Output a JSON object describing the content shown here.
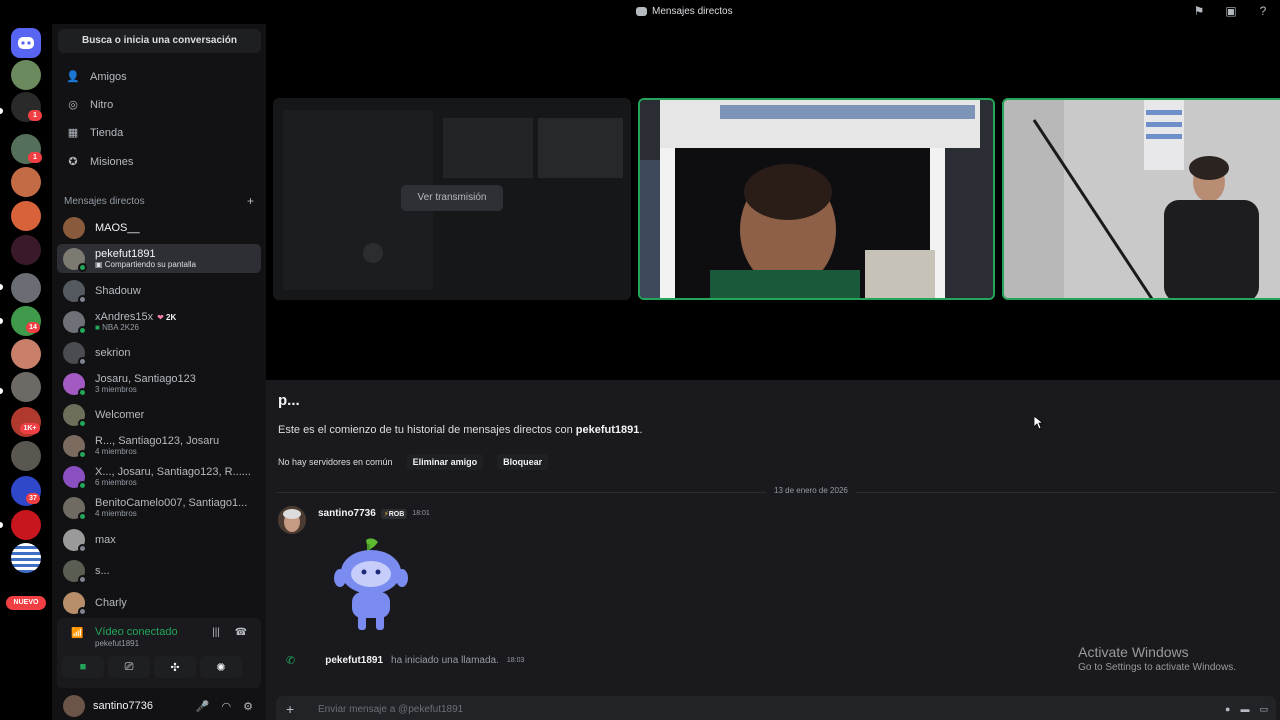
{
  "window": {
    "title": "Mensajes directos"
  },
  "titlebar_icons": [
    "flag-icon",
    "inbox-icon",
    "help-icon"
  ],
  "servers": {
    "badges": [
      "1",
      "1",
      "14",
      "1K+",
      "37"
    ],
    "new_label": "NUEVO"
  },
  "sidebar": {
    "search_label": "Busca o inicia una conversación",
    "nav": [
      {
        "label": "Amigos",
        "icon": "friends-icon"
      },
      {
        "label": "Nitro",
        "icon": "nitro-icon"
      },
      {
        "label": "Tienda",
        "icon": "shop-icon"
      },
      {
        "label": "Misiones",
        "icon": "quests-icon"
      }
    ],
    "dm_header": "Mensajes directos",
    "dms": [
      {
        "name": "MAOS__",
        "sub": ""
      },
      {
        "name": "pekefut1891",
        "sub": "Compartiendo su pantalla"
      },
      {
        "name": "Shadouw",
        "sub": ""
      },
      {
        "name": "xAndres15x",
        "badge": "2K",
        "sub": "NBA 2K26"
      },
      {
        "name": "sekrion",
        "sub": ""
      },
      {
        "name": "Josaru, Santiago123",
        "sub": "3 miembros"
      },
      {
        "name": "Welcomer",
        "sub": ""
      },
      {
        "name": "R..., Santiago123, Josaru",
        "sub": "4 miembros"
      },
      {
        "name": "X..., Josaru, Santiago123, R......",
        "sub": "6 miembros"
      },
      {
        "name": "BenitoCamelo007, Santiago1...",
        "sub": "4 miembros"
      },
      {
        "name": "max",
        "sub": ""
      },
      {
        "name": "s...",
        "sub": ""
      },
      {
        "name": "Charly",
        "sub": ""
      }
    ]
  },
  "voice": {
    "status": "Vídeo conectado",
    "channel": "pekefut1891"
  },
  "user": {
    "name": "santino7736"
  },
  "call": {
    "watch_stream_label": "Ver transmisión"
  },
  "chat": {
    "heading": "p...",
    "intro_prefix": "Este es el comienzo de tu historial de mensajes directos con ",
    "intro_name": "pekefut1891",
    "intro_suffix": ".",
    "no_servers": "No hay servidores en común",
    "remove_friend": "Eliminar amigo",
    "block": "Bloquear",
    "date_divider": "13 de enero de 2026",
    "message": {
      "author": "santino7736",
      "tag": "ROB",
      "time": "18:01"
    },
    "call_event": {
      "who": "pekefut1891",
      "what": "ha iniciado una llamada.",
      "time": "18:03"
    },
    "composer_placeholder": "Enviar mensaje a @pekefut1891"
  },
  "watermark": {
    "line1": "Activate Windows",
    "line2": "Go to Settings to activate Windows."
  },
  "colors": {
    "online": "#23a55a",
    "badge": "#f23f43",
    "blurple": "#5865f2"
  }
}
